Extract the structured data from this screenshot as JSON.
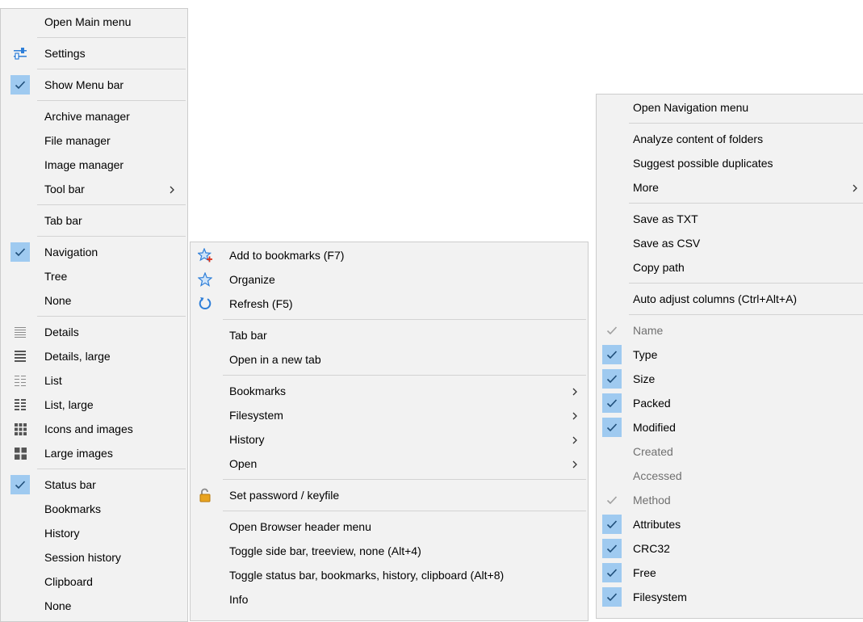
{
  "main_menu": {
    "items": [
      {
        "type": "item",
        "label": "Open Main menu"
      },
      {
        "type": "sep"
      },
      {
        "type": "item",
        "label": "Settings",
        "icon": "settings-sliders-icon"
      },
      {
        "type": "sep"
      },
      {
        "type": "item",
        "label": "Show Menu bar",
        "checked": true
      },
      {
        "type": "sep"
      },
      {
        "type": "item",
        "label": "Archive manager"
      },
      {
        "type": "item",
        "label": "File manager"
      },
      {
        "type": "item",
        "label": "Image manager"
      },
      {
        "type": "item",
        "label": "Tool bar",
        "submenu": true
      },
      {
        "type": "sep"
      },
      {
        "type": "item",
        "label": "Tab bar"
      },
      {
        "type": "sep"
      },
      {
        "type": "item",
        "label": "Navigation",
        "checked": true
      },
      {
        "type": "item",
        "label": "Tree"
      },
      {
        "type": "item",
        "label": "None"
      },
      {
        "type": "sep"
      },
      {
        "type": "item",
        "label": "Details",
        "icon": "details-view-icon"
      },
      {
        "type": "item",
        "label": "Details, large",
        "icon": "details-large-view-icon"
      },
      {
        "type": "item",
        "label": "List",
        "icon": "list-view-icon"
      },
      {
        "type": "item",
        "label": "List, large",
        "icon": "list-large-view-icon"
      },
      {
        "type": "item",
        "label": "Icons and images",
        "icon": "icons-view-icon"
      },
      {
        "type": "item",
        "label": "Large images",
        "icon": "large-images-view-icon"
      },
      {
        "type": "sep"
      },
      {
        "type": "item",
        "label": "Status bar",
        "checked": true
      },
      {
        "type": "item",
        "label": "Bookmarks"
      },
      {
        "type": "item",
        "label": "History"
      },
      {
        "type": "item",
        "label": "Session history"
      },
      {
        "type": "item",
        "label": "Clipboard"
      },
      {
        "type": "item",
        "label": "None"
      }
    ]
  },
  "browser_menu": {
    "items": [
      {
        "type": "item",
        "label": "Add to bookmarks (F7)",
        "icon": "add-bookmark-star-icon"
      },
      {
        "type": "item",
        "label": "Organize",
        "icon": "star-icon"
      },
      {
        "type": "item",
        "label": "Refresh (F5)",
        "icon": "refresh-icon"
      },
      {
        "type": "sep"
      },
      {
        "type": "item",
        "label": "Tab bar"
      },
      {
        "type": "item",
        "label": "Open in a new tab"
      },
      {
        "type": "sep"
      },
      {
        "type": "item",
        "label": "Bookmarks",
        "submenu": true
      },
      {
        "type": "item",
        "label": "Filesystem",
        "submenu": true
      },
      {
        "type": "item",
        "label": "History",
        "submenu": true
      },
      {
        "type": "item",
        "label": "Open",
        "submenu": true
      },
      {
        "type": "sep"
      },
      {
        "type": "item",
        "label": "Set password / keyfile",
        "icon": "padlock-icon"
      },
      {
        "type": "sep"
      },
      {
        "type": "item",
        "label": "Open Browser header menu"
      },
      {
        "type": "item",
        "label": "Toggle side bar, treeview, none (Alt+4)"
      },
      {
        "type": "item",
        "label": "Toggle status bar, bookmarks, history, clipboard (Alt+8)"
      },
      {
        "type": "item",
        "label": "Info"
      }
    ]
  },
  "navigation_menu": {
    "items": [
      {
        "type": "item",
        "label": "Open Navigation menu"
      },
      {
        "type": "sep"
      },
      {
        "type": "item",
        "label": "Analyze content of folders"
      },
      {
        "type": "item",
        "label": "Suggest possible duplicates"
      },
      {
        "type": "item",
        "label": "More",
        "submenu": true
      },
      {
        "type": "sep"
      },
      {
        "type": "item",
        "label": "Save as TXT"
      },
      {
        "type": "item",
        "label": "Save as CSV"
      },
      {
        "type": "item",
        "label": "Copy path"
      },
      {
        "type": "sep"
      },
      {
        "type": "item",
        "label": "Auto adjust columns (Ctrl+Alt+A)"
      },
      {
        "type": "sep"
      },
      {
        "type": "item",
        "label": "Name",
        "checked": "grey",
        "disabled": true
      },
      {
        "type": "item",
        "label": "Type",
        "checked": true
      },
      {
        "type": "item",
        "label": "Size",
        "checked": true
      },
      {
        "type": "item",
        "label": "Packed",
        "checked": true
      },
      {
        "type": "item",
        "label": "Modified",
        "checked": true
      },
      {
        "type": "item",
        "label": "Created",
        "disabled": true
      },
      {
        "type": "item",
        "label": "Accessed",
        "disabled": true
      },
      {
        "type": "item",
        "label": "Method",
        "checked": "grey",
        "disabled": true
      },
      {
        "type": "item",
        "label": "Attributes",
        "checked": true
      },
      {
        "type": "item",
        "label": "CRC32",
        "checked": true
      },
      {
        "type": "item",
        "label": "Free",
        "checked": true
      },
      {
        "type": "item",
        "label": "Filesystem",
        "checked": true
      }
    ]
  },
  "colors": {
    "menu_bg": "#f2f2f2",
    "check_bg": "#9fcaf0",
    "check_mark": "#1f4e79",
    "disabled_text": "#707070",
    "icon_blue": "#2f7fd8"
  }
}
